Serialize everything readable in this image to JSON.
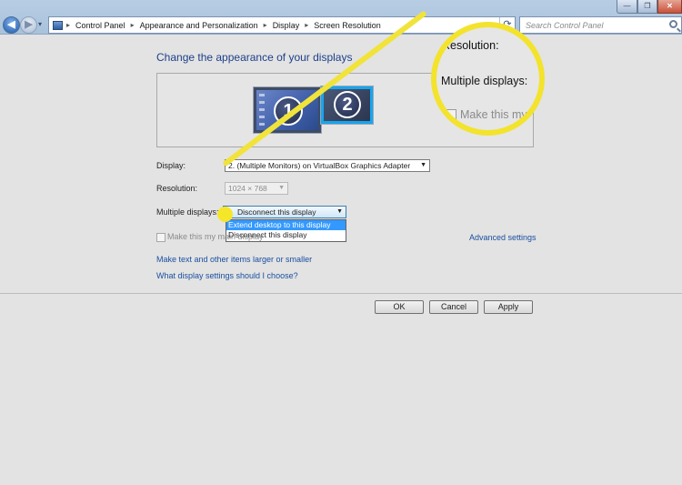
{
  "window": {
    "minimize_glyph": "—",
    "maximize_glyph": "❐",
    "close_glyph": "✕"
  },
  "nav": {
    "back_glyph": "◀",
    "forward_glyph": "▶",
    "history_glyph": "▾"
  },
  "address_bar": {
    "crumbs": [
      "Control Panel",
      "Appearance and Personalization",
      "Display",
      "Screen Resolution"
    ],
    "separator": "▸",
    "refresh_glyph": "⟳"
  },
  "search": {
    "placeholder": "Search Control Panel",
    "icon": "search-icon"
  },
  "page": {
    "heading": "Change the appearance of your displays",
    "monitors": [
      "1",
      "2"
    ]
  },
  "fields": {
    "display_label": "Display:",
    "display_value": "2. (Multiple Monitors) on VirtualBox Graphics Adapter",
    "resolution_label": "Resolution:",
    "resolution_value": "1024 × 768",
    "multiple_label": "Multiple displays:",
    "multiple_value": "Disconnect this display",
    "arrow_glyph": "▼"
  },
  "dropdown": {
    "options": [
      "Extend desktop to this display",
      "Disconnect this display"
    ],
    "selected_index": 0
  },
  "checkbox": {
    "label": "Make this my main display",
    "checked": false
  },
  "links": {
    "advanced": "Advanced settings",
    "larger_text": "Make text and other items larger or smaller",
    "which_settings": "What display settings should I choose?"
  },
  "buttons": {
    "ok": "OK",
    "cancel": "Cancel",
    "apply": "Apply"
  },
  "callout": {
    "resolution": "Resolution:",
    "multiple": "Multiple displays:",
    "make": "Make this my",
    "color": "#f3e32c"
  },
  "colors": {
    "heading": "#1e3f8a",
    "link": "#1a4fa0",
    "selection": "#3399ff"
  }
}
